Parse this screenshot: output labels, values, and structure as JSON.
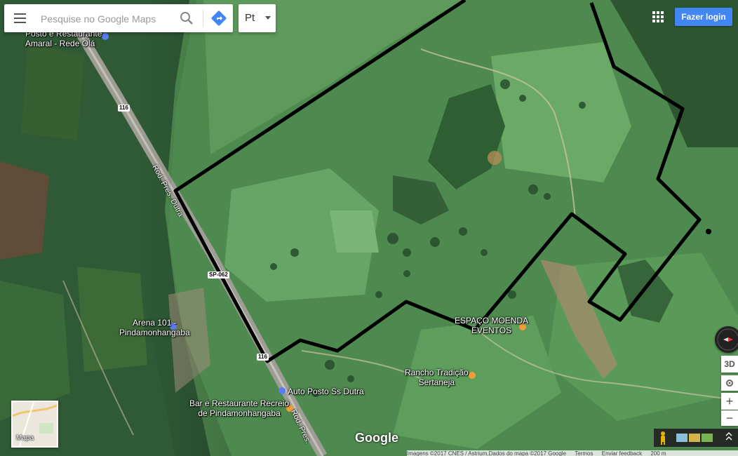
{
  "search": {
    "placeholder": "Pesquise no Google Maps"
  },
  "language": {
    "selected": "Pt"
  },
  "header": {
    "login_label": "Fazer login"
  },
  "places": {
    "posto_restaurante": "Posto e Restaurante\nAmaral - Rede Olá",
    "arena": "Arena 101 -\nPindamonhangaba",
    "espaco_moenda": "ESPAÇO MOENDA\nEVENTOS",
    "rancho": "Rancho Tradição\nSertaneja",
    "auto_posto": "Auto Posto Ss Dutra",
    "bar_restaurante": "Bar e Restaurante Recreio\nde Pindamonhangaba"
  },
  "roads": {
    "dutra_upper": "Rod. Pres. Dutra",
    "dutra_lower": "Rod. Pres.",
    "shield_116": "116",
    "shield_sp": "SP-062",
    "shield_116b": "116"
  },
  "minimap": {
    "label": "Mapa"
  },
  "brand": {
    "logo": "Google"
  },
  "controls": {
    "tilt_3d": "3D",
    "zoom_in": "+",
    "zoom_out": "−"
  },
  "footer": {
    "attribution": "Imagens ©2017 CNES / Astrium,Dados do mapa ©2017 Google",
    "terms": "Termos",
    "feedback": "Enviar feedback",
    "scale": "200 m"
  },
  "colors": {
    "login_blue": "#4285f4",
    "boundary": "#000000",
    "poi_orange": "#f29e36",
    "poi_blue": "#5a7cf2"
  }
}
